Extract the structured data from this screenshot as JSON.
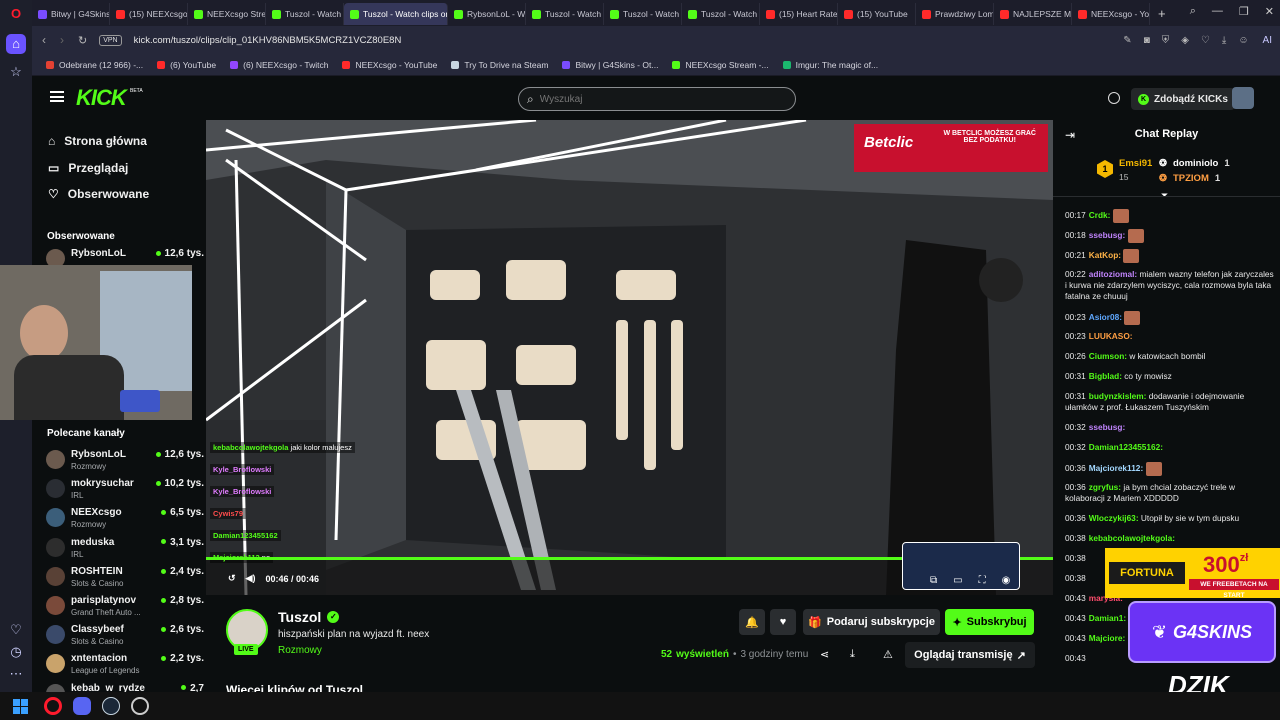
{
  "browser": {
    "tabs": [
      {
        "label": "Bitwy | G4Skins",
        "color": "#7a4cff"
      },
      {
        "label": "(15) NEEXcsgo",
        "color": "#ff2a2a"
      },
      {
        "label": "NEEXcsgo Strea",
        "color": "#53fc18"
      },
      {
        "label": "Tuszol - Watch",
        "color": "#53fc18"
      },
      {
        "label": "Tuszol - Watch clips on K",
        "color": "#53fc18",
        "active": true
      },
      {
        "label": "RybsonLoL - W",
        "color": "#53fc18"
      },
      {
        "label": "Tuszol - Watch",
        "color": "#53fc18"
      },
      {
        "label": "Tuszol - Watch",
        "color": "#53fc18"
      },
      {
        "label": "Tuszol - Watch",
        "color": "#53fc18"
      },
      {
        "label": "(15) Heart Rate",
        "color": "#ff2a2a"
      },
      {
        "label": "(15) YouTube",
        "color": "#ff2a2a"
      },
      {
        "label": "Prawdziwy Lom",
        "color": "#ff2a2a"
      },
      {
        "label": "NAJLEPSZE MC",
        "color": "#ff2a2a"
      },
      {
        "label": "NEEXcsgo - Yo",
        "color": "#ff2a2a"
      }
    ],
    "url": "kick.com/tuszol/clips/clip_01KHV86NBM5K5MCRZ1VCZ80E8N",
    "vpn_label": "VPN",
    "ai_label": "AI",
    "bookmarks": [
      {
        "label": "Odebrane (12 966) -...",
        "color": "#e34133"
      },
      {
        "label": "(6) YouTube",
        "color": "#ff2a2a"
      },
      {
        "label": "(6) NEEXcsgo - Twitch",
        "color": "#9146ff"
      },
      {
        "label": "NEEXcsgo - YouTube",
        "color": "#ff2a2a"
      },
      {
        "label": "Try To Drive na Steam",
        "color": "#c7d5e0"
      },
      {
        "label": "Bitwy | G4Skins - Ot...",
        "color": "#7a4cff"
      },
      {
        "label": "NEEXcsgo Stream -...",
        "color": "#53fc18"
      },
      {
        "label": "Imgur: The magic of...",
        "color": "#1bb76e"
      }
    ]
  },
  "kick": {
    "logo": "KICK",
    "logo_beta": "BETA",
    "search_placeholder": "Wyszukaj",
    "get_kicks": "Zdobądź KICKs",
    "nav": {
      "home": "Strona główna",
      "browse": "Przeglądaj",
      "following": "Obserwowane"
    },
    "followed_title": "Obserwowane",
    "followed": [
      {
        "name": "RybsonLoL",
        "viewers": "12,6 tys."
      }
    ],
    "recommended_title": "Polecane kanały",
    "recommended": [
      {
        "name": "RybsonLoL",
        "category": "Rozmowy",
        "viewers": "12,6 tys.",
        "color": "#6b5a4e"
      },
      {
        "name": "mokrysuchar",
        "category": "IRL",
        "viewers": "10,2 tys.",
        "color": "#2a2d33"
      },
      {
        "name": "NEEXcsgo",
        "category": "Rozmowy",
        "viewers": "6,5 tys.",
        "color": "#3b5e7a"
      },
      {
        "name": "meduska",
        "category": "IRL",
        "viewers": "3,1 tys.",
        "color": "#2d2d2d"
      },
      {
        "name": "ROSHTEIN",
        "category": "Slots & Casino",
        "viewers": "2,4 tys.",
        "color": "#594136"
      },
      {
        "name": "parisplatynov",
        "category": "Grand Theft Auto ...",
        "viewers": "2,8 tys.",
        "color": "#7a4a3a"
      },
      {
        "name": "Classybeef",
        "category": "Slots & Casino",
        "viewers": "2,6 tys.",
        "color": "#3a4a6a"
      },
      {
        "name": "xntentacion",
        "category": "League of Legends",
        "viewers": "2,2 tys.",
        "color": "#c9a36b"
      },
      {
        "name": "kebab_w_rydze",
        "category": "",
        "viewers": "2,7",
        "color": "#555"
      }
    ],
    "player": {
      "time_current": "00:46",
      "time_total": "00:46",
      "progress": 1.0,
      "sponsor_line1": "W BETCLIC MOŻESZ GRAĆ",
      "sponsor_line2": "BEZ PODATKU!",
      "sponsor_brand": "Betclic",
      "overlay_chat": [
        {
          "user": "kebabcolawojtekgola",
          "text": "jaki kolor malujesz",
          "color": "#53fc18"
        },
        {
          "user": "Kyle_Broflowski",
          "text": "",
          "color": "#e07cff"
        },
        {
          "user": "Kyle_Broflowski",
          "text": "",
          "color": "#e07cff"
        },
        {
          "user": "Cywis79",
          "text": "",
          "color": "#ff4d4d"
        },
        {
          "user": "Damian123455162",
          "text": "",
          "color": "#53fc18"
        },
        {
          "user": "Majciorek112",
          "text": "no",
          "color": "#53fc18"
        }
      ]
    },
    "streamer": {
      "name": "Tuszol",
      "title": "hiszpański plan na wyjazd ft. neex",
      "category": "Rozmowy",
      "live_badge": "LIVE",
      "views_count": "52",
      "views_label": "wyświetleń",
      "time_ago": "3 godziny temu"
    },
    "buttons": {
      "gift": "Podaruj subskrypcje",
      "subscribe": "Subskrybuj",
      "watch_stream": "Oglądaj transmisję"
    },
    "more_from": "Więcej klipów od Tuszol"
  },
  "chat": {
    "title": "Chat Replay",
    "leaderboard": {
      "first": {
        "rank": "1",
        "name": "Emsi91",
        "score": "15"
      },
      "others": [
        {
          "name": "dominiolo",
          "score": "1"
        },
        {
          "name": "TPZIOM",
          "score": "1"
        }
      ]
    },
    "messages": [
      {
        "time": "00:17",
        "user": "Crdk",
        "text": "",
        "color": "#53fc18",
        "emote": true
      },
      {
        "time": "00:18",
        "user": "ssebusg",
        "text": "",
        "color": "#c084fc",
        "emote": true
      },
      {
        "time": "00:21",
        "user": "KatKop",
        "text": "",
        "color": "#ffb347",
        "emote": true
      },
      {
        "time": "00:22",
        "user": "aditoziomal",
        "text": "mialem wazny telefon jak zaryczales i kurwa nie zdarzylem wyciszyc, cala rozmowa byla taka fatalna ze chuuuj",
        "color": "#c084fc"
      },
      {
        "time": "00:23",
        "user": "Asior08",
        "text": "",
        "color": "#5fa8ff",
        "emote": true
      },
      {
        "time": "00:23",
        "user": "LUUKASO",
        "text": "",
        "color": "#ff9f43"
      },
      {
        "time": "00:26",
        "user": "Ciumson",
        "text": "w katowicach bombil",
        "color": "#53fc18"
      },
      {
        "time": "00:31",
        "user": "Bigblad",
        "text": "co ty mowisz",
        "color": "#53fc18"
      },
      {
        "time": "00:31",
        "user": "budynzkislem",
        "text": "dodawanie i odejmowanie ułamków z prof. Łukaszem Tuszyńskim",
        "color": "#53fc18"
      },
      {
        "time": "00:32",
        "user": "ssebusg",
        "text": "",
        "color": "#c084fc"
      },
      {
        "time": "00:32",
        "user": "Damian123455162",
        "text": "",
        "color": "#53fc18"
      },
      {
        "time": "00:36",
        "user": "Majciorek112",
        "text": "",
        "color": "#a4d8ff",
        "emote": true
      },
      {
        "time": "00:36",
        "user": "zgryfus",
        "text": "ja bym chcial zobaczyć trele w kolaboracji z Mariem XDDDDD",
        "color": "#53fc18"
      },
      {
        "time": "00:36",
        "user": "Wloczykij63",
        "text": "Utopił by sie w tym dupsku",
        "color": "#53fc18"
      },
      {
        "time": "00:38",
        "user": "kebabcolawojtekgola",
        "text": "",
        "color": "#53fc18"
      },
      {
        "time": "00:38",
        "user": "",
        "text": "",
        "color": "#53fc18"
      },
      {
        "time": "00:38",
        "user": "",
        "text": "",
        "color": "#53fc18"
      },
      {
        "time": "00:43",
        "user": "marysia",
        "text": "",
        "color": "#ff4d6d"
      },
      {
        "time": "00:43",
        "user": "Damian1",
        "text": "",
        "color": "#53fc18"
      },
      {
        "time": "00:43",
        "user": "Majciore",
        "text": "",
        "color": "#53fc18"
      },
      {
        "time": "00:43",
        "user": "",
        "text": "",
        "color": "#53fc18"
      }
    ]
  },
  "ads": {
    "fortuna_brand": "FORTUNA",
    "fortuna_amount": "300",
    "fortuna_currency": "zł",
    "fortuna_tag": "WE FREEBETACH NA START",
    "g4skins": "G4SKINS",
    "dzik": "DZIK"
  }
}
